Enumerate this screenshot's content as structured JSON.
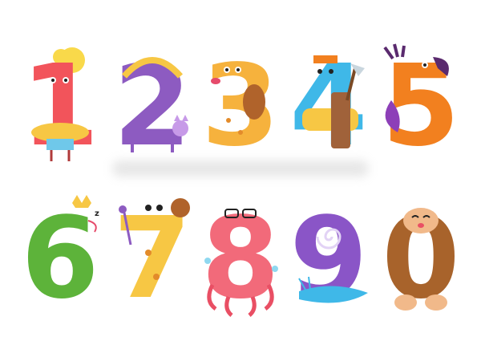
{
  "illustration": {
    "row1": [
      {
        "digit": "1",
        "character": "horse",
        "color": "#f2545b"
      },
      {
        "digit": "2",
        "character": "cat",
        "color": "#8d5bc1"
      },
      {
        "digit": "3",
        "character": "giraffe",
        "color": "#f6b23d"
      },
      {
        "digit": "4",
        "character": "badger",
        "color": "#3fb8e8"
      },
      {
        "digit": "5",
        "character": "parrot",
        "color": "#f2801f"
      }
    ],
    "row2": [
      {
        "digit": "6",
        "character": "snake",
        "color": "#5db33a"
      },
      {
        "digit": "7",
        "character": "giraffe",
        "color": "#f7c744"
      },
      {
        "digit": "8",
        "character": "octopus",
        "color": "#f26a7a"
      },
      {
        "digit": "9",
        "character": "snail",
        "color": "#8a55c7"
      },
      {
        "digit": "0",
        "character": "monkey",
        "color": "#a8632b"
      }
    ]
  }
}
